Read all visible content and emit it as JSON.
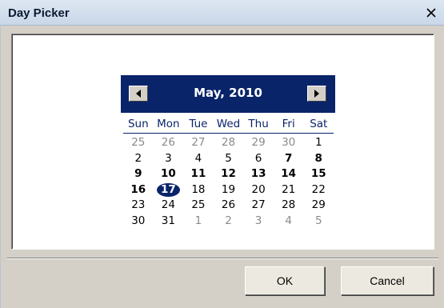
{
  "window": {
    "title": "Day Picker"
  },
  "calendar": {
    "month_title": "May, 2010",
    "weekdays": [
      "Sun",
      "Mon",
      "Tue",
      "Wed",
      "Thu",
      "Fri",
      "Sat"
    ],
    "weeks": [
      [
        {
          "d": "25",
          "other": true
        },
        {
          "d": "26",
          "other": true
        },
        {
          "d": "27",
          "other": true
        },
        {
          "d": "28",
          "other": true
        },
        {
          "d": "29",
          "other": true
        },
        {
          "d": "30",
          "other": true
        },
        {
          "d": "1"
        }
      ],
      [
        {
          "d": "2"
        },
        {
          "d": "3"
        },
        {
          "d": "4"
        },
        {
          "d": "5"
        },
        {
          "d": "6"
        },
        {
          "d": "7",
          "bold": true
        },
        {
          "d": "8",
          "bold": true
        }
      ],
      [
        {
          "d": "9",
          "bold": true
        },
        {
          "d": "10",
          "bold": true
        },
        {
          "d": "11",
          "bold": true
        },
        {
          "d": "12",
          "bold": true
        },
        {
          "d": "13",
          "bold": true
        },
        {
          "d": "14",
          "bold": true
        },
        {
          "d": "15",
          "bold": true
        }
      ],
      [
        {
          "d": "16",
          "bold": true
        },
        {
          "d": "17",
          "today": true
        },
        {
          "d": "18"
        },
        {
          "d": "19"
        },
        {
          "d": "20"
        },
        {
          "d": "21"
        },
        {
          "d": "22"
        }
      ],
      [
        {
          "d": "23"
        },
        {
          "d": "24"
        },
        {
          "d": "25"
        },
        {
          "d": "26"
        },
        {
          "d": "27"
        },
        {
          "d": "28"
        },
        {
          "d": "29"
        }
      ],
      [
        {
          "d": "30"
        },
        {
          "d": "31"
        },
        {
          "d": "1",
          "other": true
        },
        {
          "d": "2",
          "other": true
        },
        {
          "d": "3",
          "other": true
        },
        {
          "d": "4",
          "other": true
        },
        {
          "d": "5",
          "other": true
        }
      ]
    ],
    "colors": {
      "header": "#0a246a",
      "other_month": "#8a8a8a",
      "selected": "#0a246a"
    }
  },
  "buttons": {
    "ok": "OK",
    "cancel": "Cancel"
  },
  "icons": {
    "close": "close-icon",
    "prev": "left-arrow-icon",
    "next": "right-arrow-icon"
  }
}
